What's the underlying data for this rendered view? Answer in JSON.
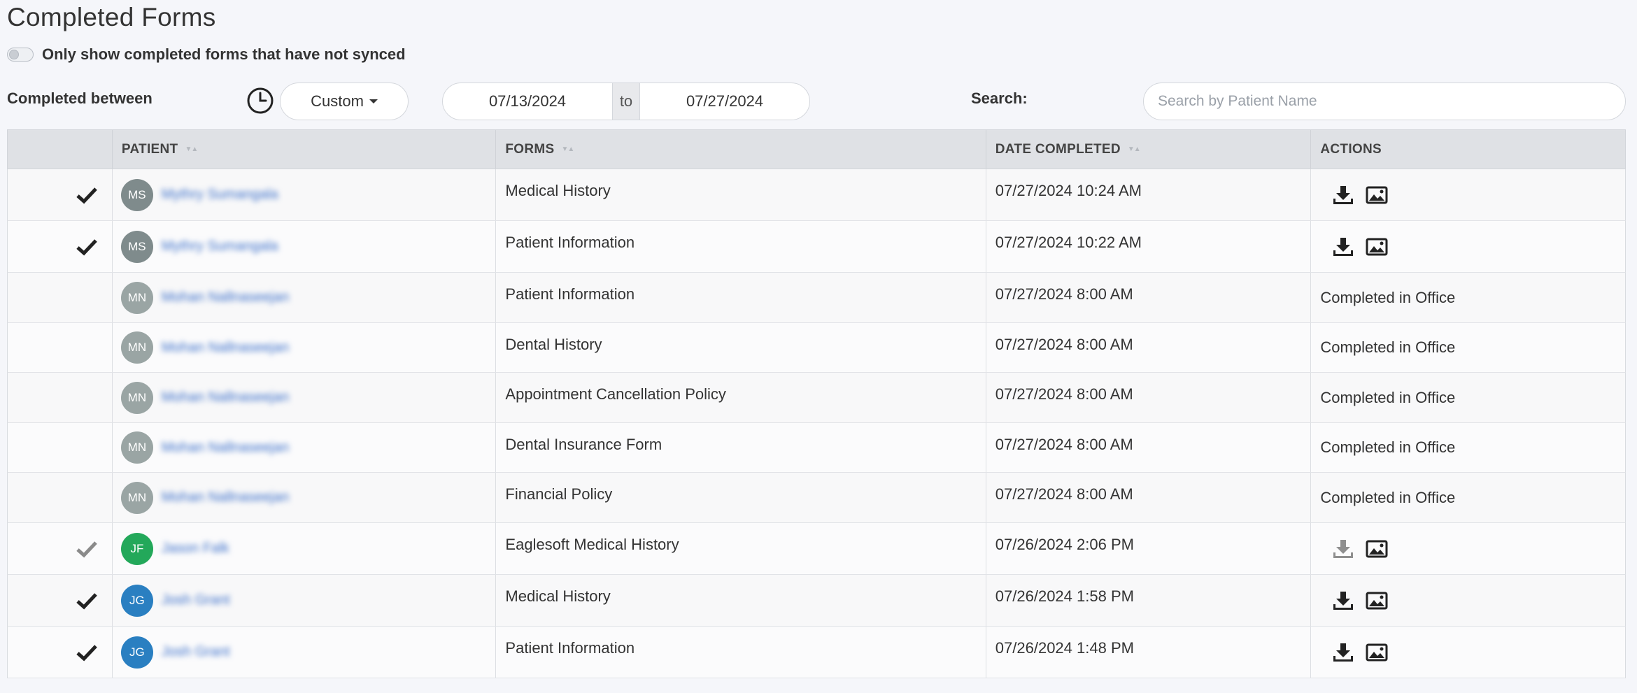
{
  "page": {
    "title": "Completed Forms"
  },
  "toggle": {
    "label": "Only show completed forms that have not synced"
  },
  "filters": {
    "completed_between_label": "Completed between",
    "range_option": "Custom",
    "date_from": "07/13/2024",
    "date_separator": "to",
    "date_to": "07/27/2024",
    "search_label": "Search:",
    "search_placeholder": "Search by Patient Name"
  },
  "table": {
    "headers": [
      "",
      "PATIENT",
      "FORMS",
      "DATE COMPLETED",
      "ACTIONS"
    ],
    "rows": [
      {
        "synced": "dark",
        "initials": "MS",
        "avatar_color": "#7f8b8c",
        "patient": "Mythry Sumangala",
        "form": "Medical History",
        "date": "07/27/2024 10:24 AM",
        "action_type": "icons",
        "download_color": "#222",
        "action_text": ""
      },
      {
        "synced": "dark",
        "initials": "MS",
        "avatar_color": "#7f8b8c",
        "patient": "Mythry Sumangala",
        "form": "Patient Information",
        "date": "07/27/2024 10:22 AM",
        "action_type": "icons",
        "download_color": "#222",
        "action_text": ""
      },
      {
        "synced": "none",
        "initials": "MN",
        "avatar_color": "#9aa5a4",
        "patient": "Mohan Nallnaseejan",
        "form": "Patient Information",
        "date": "07/27/2024 8:00 AM",
        "action_type": "text",
        "action_text": "Completed in Office"
      },
      {
        "synced": "none",
        "initials": "MN",
        "avatar_color": "#9aa5a4",
        "patient": "Mohan Nallnaseejan",
        "form": "Dental History",
        "date": "07/27/2024 8:00 AM",
        "action_type": "text",
        "action_text": "Completed in Office"
      },
      {
        "synced": "none",
        "initials": "MN",
        "avatar_color": "#9aa5a4",
        "patient": "Mohan Nallnaseejan",
        "form": "Appointment Cancellation Policy",
        "date": "07/27/2024 8:00 AM",
        "action_type": "text",
        "action_text": "Completed in Office"
      },
      {
        "synced": "none",
        "initials": "MN",
        "avatar_color": "#9aa5a4",
        "patient": "Mohan Nallnaseejan",
        "form": "Dental Insurance Form",
        "date": "07/27/2024 8:00 AM",
        "action_type": "text",
        "action_text": "Completed in Office"
      },
      {
        "synced": "none",
        "initials": "MN",
        "avatar_color": "#9aa5a4",
        "patient": "Mohan Nallnaseejan",
        "form": "Financial Policy",
        "date": "07/27/2024 8:00 AM",
        "action_type": "text",
        "action_text": "Completed in Office"
      },
      {
        "synced": "light",
        "initials": "JF",
        "avatar_color": "#23a85a",
        "patient": "Jason Falk",
        "form": "Eaglesoft Medical History",
        "date": "07/26/2024 2:06 PM",
        "action_type": "icons",
        "download_color": "#8f8f8f",
        "action_text": ""
      },
      {
        "synced": "dark",
        "initials": "JG",
        "avatar_color": "#2a7fc1",
        "patient": "Josh Grant",
        "form": "Medical History",
        "date": "07/26/2024 1:58 PM",
        "action_type": "icons",
        "download_color": "#222",
        "action_text": ""
      },
      {
        "synced": "dark",
        "initials": "JG",
        "avatar_color": "#2a7fc1",
        "patient": "Josh Grant",
        "form": "Patient Information",
        "date": "07/26/2024 1:48 PM",
        "action_type": "icons",
        "download_color": "#222",
        "action_text": ""
      }
    ]
  }
}
